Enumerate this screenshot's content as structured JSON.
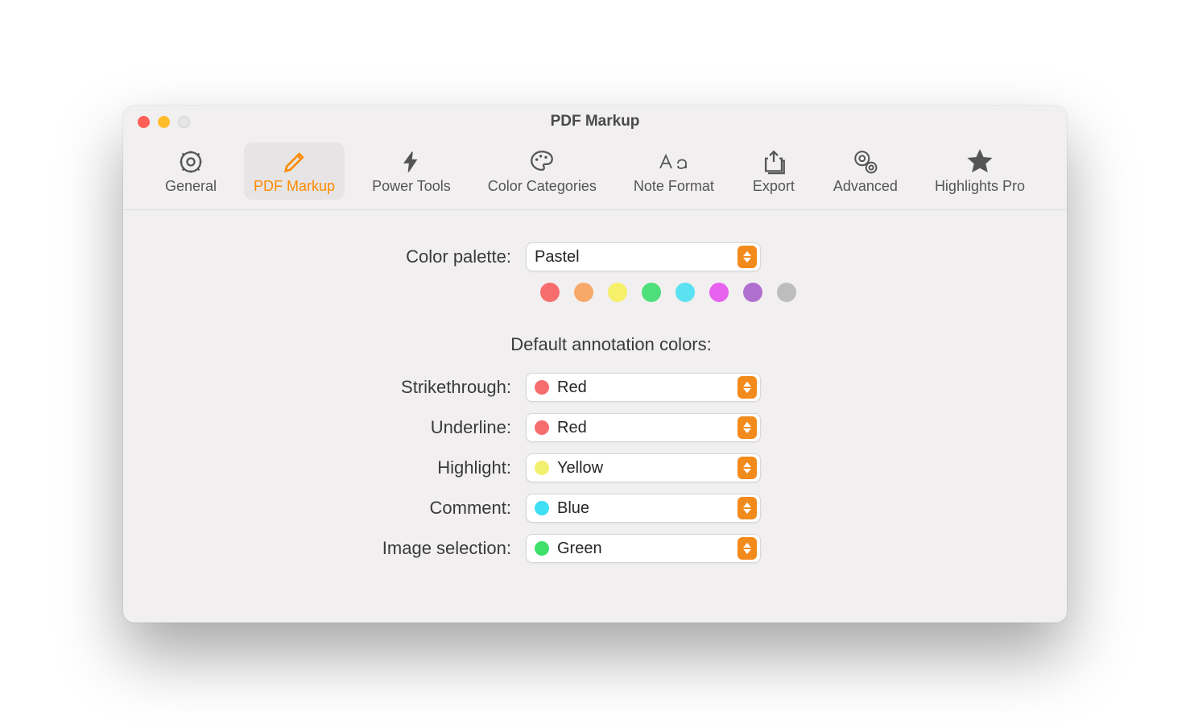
{
  "window": {
    "title": "PDF Markup"
  },
  "toolbar": {
    "items": [
      {
        "label": "General"
      },
      {
        "label": "PDF Markup"
      },
      {
        "label": "Power Tools"
      },
      {
        "label": "Color Categories"
      },
      {
        "label": "Note Format"
      },
      {
        "label": "Export"
      },
      {
        "label": "Advanced"
      },
      {
        "label": "Highlights Pro"
      }
    ],
    "active_index": 1
  },
  "labels": {
    "color_palette": "Color palette:",
    "default_colors": "Default annotation colors:",
    "strikethrough": "Strikethrough:",
    "underline": "Underline:",
    "highlight": "Highlight:",
    "comment": "Comment:",
    "image_selection": "Image selection:"
  },
  "palette": {
    "value": "Pastel",
    "swatches": [
      "#f76d6d",
      "#f7a96a",
      "#f6f06a",
      "#4de07a",
      "#5ae1f2",
      "#e861ef",
      "#b06fcf",
      "#bdbdbd"
    ]
  },
  "defaults": {
    "strikethrough": {
      "label": "Red",
      "color": "#f76d6d"
    },
    "underline": {
      "label": "Red",
      "color": "#f76d6d"
    },
    "highlight": {
      "label": "Yellow",
      "color": "#f3ef6f"
    },
    "comment": {
      "label": "Blue",
      "color": "#3fe0f5"
    },
    "image_selection": {
      "label": "Green",
      "color": "#3fe06a"
    }
  },
  "colors": {
    "accent": "#f28a1c"
  }
}
